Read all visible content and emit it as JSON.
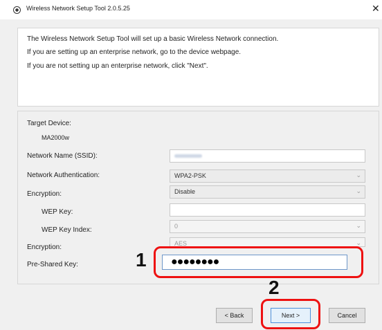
{
  "window": {
    "title": "Wireless Network Setup Tool 2.0.5.25",
    "close_glyph": "✕"
  },
  "intro": {
    "line1": "The Wireless Network Setup Tool will set up a basic Wireless Network connection.",
    "line2": "If you are setting up an enterprise network, go to the device webpage.",
    "line3": "If you are not setting up an enterprise network, click \"Next\"."
  },
  "form": {
    "target_device_label": "Target Device:",
    "target_device_value": "MA2000w",
    "ssid_label": "Network Name (SSID):",
    "ssid_value": "",
    "auth_label": "Network Authentication:",
    "auth_value": "WPA2-PSK",
    "encryption_label": "Encryption:",
    "encryption_value": "Disable",
    "wep_key_label": "WEP Key:",
    "wep_key_value": "",
    "wep_index_label": "WEP Key Index:",
    "wep_index_value": "0",
    "encryption2_label": "Encryption:",
    "encryption2_value": "AES",
    "psk_label": "Pre-Shared Key:",
    "psk_value": "●●●●●●●●"
  },
  "annotations": {
    "step1": "1",
    "step2": "2",
    "highlight_color": "#ee1111"
  },
  "buttons": {
    "back": "< Back",
    "next": "Next >",
    "cancel": "Cancel"
  },
  "icons": {
    "app": "radio-icon",
    "close": "close-icon",
    "dropdown": "chevron-down-icon"
  }
}
